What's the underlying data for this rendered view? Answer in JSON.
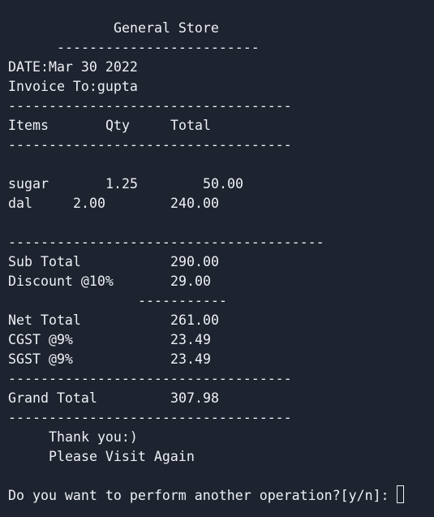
{
  "receipt": {
    "store_name": "General Store",
    "title_rule": "-------------------------",
    "date_line": "DATE:Mar 30 2022",
    "invoice_line": "Invoice To:gupta",
    "rule": "-----------------------------------",
    "rule_long": "---------------------------------------",
    "rule_short": "-----------",
    "headers": {
      "items": "Items",
      "qty": "Qty",
      "total": "Total"
    },
    "items": [
      {
        "name": "sugar",
        "qty": "1.25",
        "total": "50.00"
      },
      {
        "name": "dal",
        "qty": "2.00",
        "total": "240.00"
      }
    ],
    "summary": {
      "sub_total_label": "Sub Total",
      "sub_total_value": "290.00",
      "discount_label": "Discount @10%",
      "discount_value": "29.00",
      "net_total_label": "Net Total",
      "net_total_value": "261.00",
      "cgst_label": "CGST @9%",
      "cgst_value": "23.49",
      "sgst_label": "SGST @9%",
      "sgst_value": "23.49",
      "grand_total_label": "Grand Total",
      "grand_total_value": "307.98"
    },
    "footer": {
      "thank_you": "Thank you:)",
      "visit_again": "Please Visit Again"
    }
  },
  "prompt": {
    "text": "Do you want to perform another operation?[y/n]:"
  },
  "colors": {
    "background": "#1e2330",
    "foreground": "#eef0f4"
  }
}
